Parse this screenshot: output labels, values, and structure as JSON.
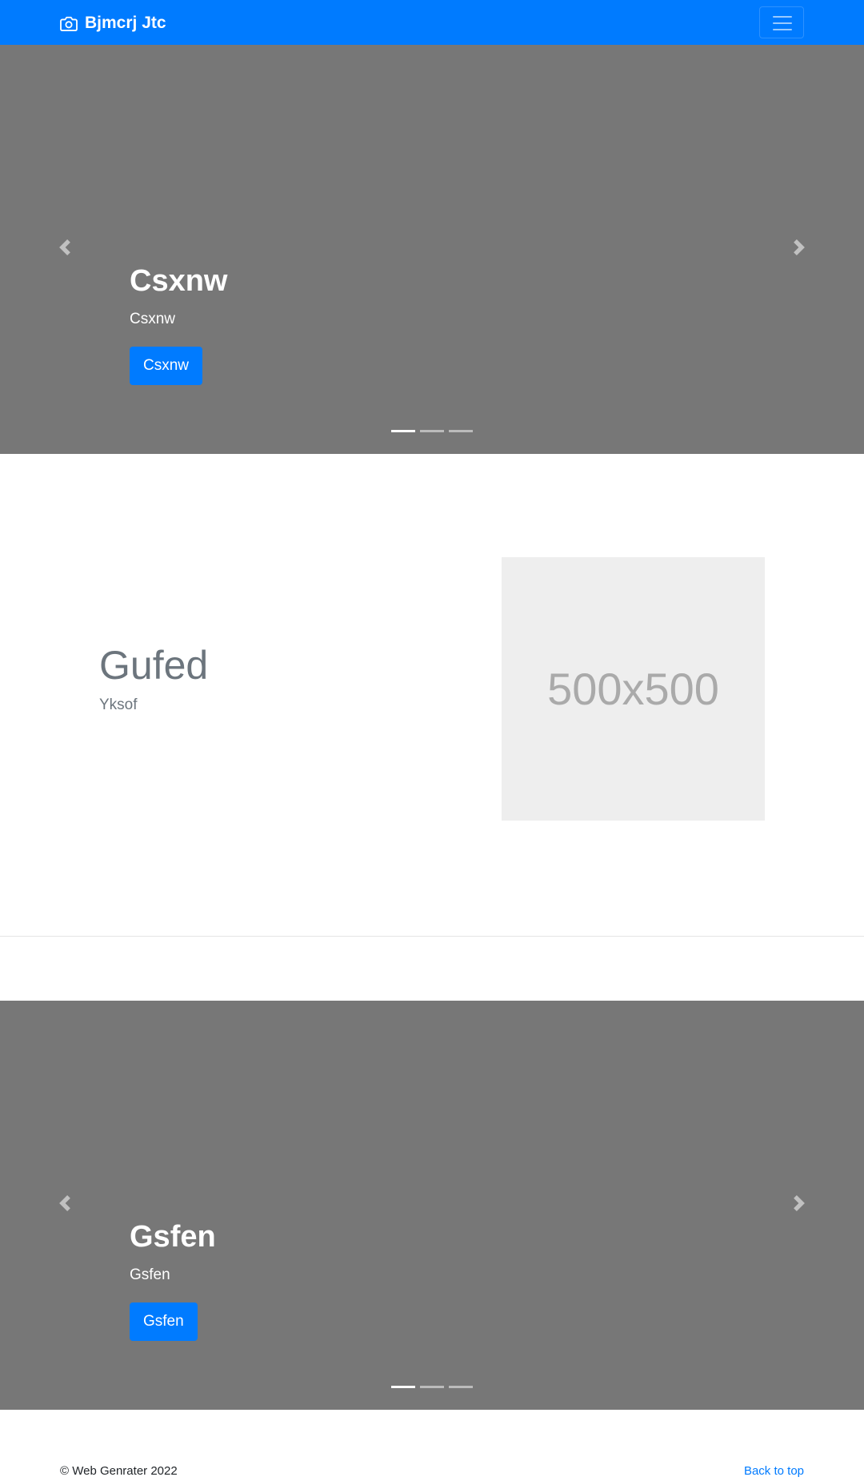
{
  "navbar": {
    "brand": "Bjmcrj Jtc",
    "brand_icon": "camera-icon",
    "toggler_icon": "hamburger-menu-icon",
    "background": "#007bff"
  },
  "carousel_1": {
    "heading": "Csxnw",
    "text": "Csxnw",
    "button": "Csxnw",
    "active_indicator": 1,
    "indicator_count": 3
  },
  "featurette": {
    "heading": "Gufed",
    "text": "Yksof",
    "image_placeholder": "500x500"
  },
  "carousel_2": {
    "heading": "Gsfen",
    "text": "Gsfen",
    "button": "Gsfen",
    "active_indicator": 1,
    "indicator_count": 3
  },
  "footer": {
    "copyright": "© Web Genrater 2022",
    "back_to_top": "Back to top"
  },
  "colors": {
    "primary": "#007bff",
    "carousel_bg": "#777777",
    "placeholder_bg": "#eeeeee",
    "muted_text": "#6c757d"
  }
}
